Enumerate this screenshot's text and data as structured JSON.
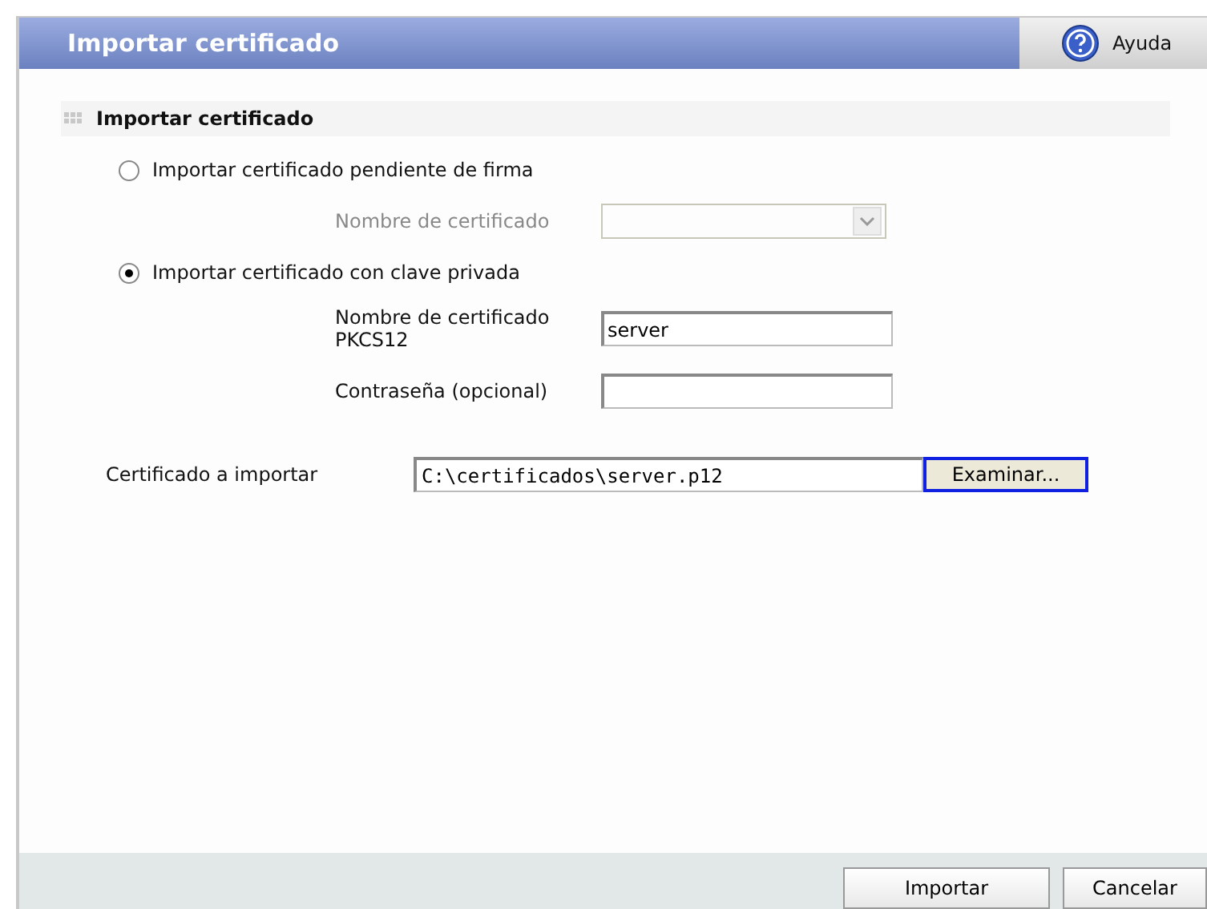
{
  "window": {
    "title": "Importar certificado",
    "help": "Ayuda"
  },
  "section": {
    "title": "Importar certificado"
  },
  "options": [
    {
      "label": "Importar certificado pendiente de firma",
      "selected": false,
      "fields": [
        {
          "kind": "select",
          "label": "Nombre de certificado",
          "disabled": true
        }
      ]
    },
    {
      "label": "Importar certificado con clave privada",
      "selected": true,
      "fields": [
        {
          "kind": "text",
          "label": "Nombre de certificado PKCS12",
          "value": "server",
          "disabled": false
        },
        {
          "kind": "text",
          "label": "Contraseña (opcional)",
          "disabled": false
        }
      ]
    }
  ],
  "file": {
    "label": "Certificado a importar",
    "value": "C:\\certificados\\server.p12",
    "button": "Examinar..."
  },
  "buttons": [
    "Importar",
    "Cancelar"
  ]
}
